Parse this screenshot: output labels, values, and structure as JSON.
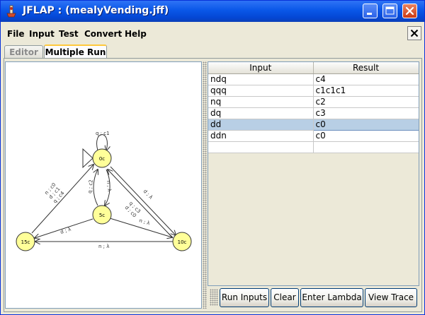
{
  "window": {
    "title": "JFLAP : (mealyVending.jff)"
  },
  "menu": {
    "items": [
      "File",
      "Input",
      "Test",
      "Convert",
      "Help"
    ]
  },
  "tabs": {
    "editor": "Editor",
    "multiple_run": "Multiple Run"
  },
  "automaton": {
    "states": {
      "s0": "0c",
      "s5": "5c",
      "s10": "10c",
      "s15": "15c"
    },
    "transitions": {
      "loop_0": "q ; c1",
      "t_0_5": "n ; λ",
      "t_5_0": "q ; c2",
      "t_0_10": "d ; λ",
      "t_10_0_a": "q ; c3",
      "t_10_0_b": "d ; c0",
      "t_15_0_a": "n ; c0",
      "t_15_0_b": "d ; c1",
      "t_15_0_c": "q ; c4",
      "t_5_15": "d ; λ",
      "t_5_10": "n ; λ",
      "t_10_15": "n ; λ"
    }
  },
  "table": {
    "headers": {
      "input": "Input",
      "result": "Result"
    },
    "rows": [
      {
        "input": "ndq",
        "result": "c4"
      },
      {
        "input": "qqq",
        "result": "c1c1c1"
      },
      {
        "input": "nq",
        "result": "c2"
      },
      {
        "input": "dq",
        "result": "c3"
      },
      {
        "input": "dd",
        "result": "c0"
      },
      {
        "input": "ddn",
        "result": "c0"
      },
      {
        "input": "",
        "result": ""
      }
    ]
  },
  "buttons": {
    "run_inputs": "Run Inputs",
    "clear": "Clear",
    "enter_lambda": "Enter Lambda",
    "view_trace": "View Trace"
  },
  "colors": {
    "state_fill": "#ffff99",
    "selection": "#b8cfe5",
    "titlebar": "#0a57e8"
  }
}
